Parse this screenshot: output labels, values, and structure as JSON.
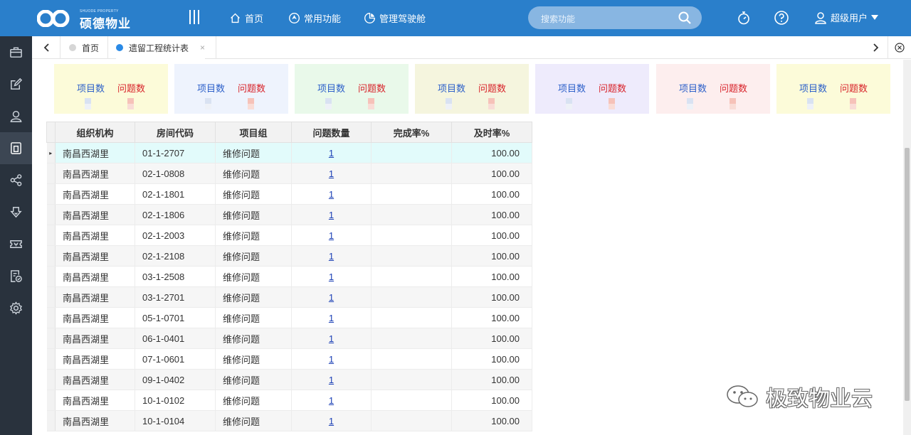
{
  "app": {
    "logo_small": "SHUODE PROPERTY",
    "logo_name": "硕德物业",
    "colors": {
      "topbar": "#2a7fcb",
      "sidebar": "#29323d",
      "link": "#1a3fb5",
      "problem_red": "#d8232a",
      "project_blue": "#2b5fc9"
    }
  },
  "header": {
    "menu_icon": "menu-bars-icon",
    "nav": [
      {
        "label": "首页",
        "icon": "home-icon"
      },
      {
        "label": "常用功能",
        "icon": "navigation-icon"
      },
      {
        "label": "管理驾驶舱",
        "icon": "pie-chart-icon"
      }
    ],
    "search_placeholder": "搜索功能",
    "user_label": "超级用户"
  },
  "sidebar": {
    "items": [
      {
        "icon": "briefcase-icon"
      },
      {
        "icon": "edit-icon"
      },
      {
        "icon": "user-icon"
      },
      {
        "icon": "building-icon",
        "active": true
      },
      {
        "icon": "share-icon"
      },
      {
        "icon": "download-icon"
      },
      {
        "icon": "ticket-icon"
      },
      {
        "icon": "checklist-icon"
      },
      {
        "icon": "settings-icon"
      }
    ]
  },
  "tabs": [
    {
      "label": "首页",
      "dot": "#d6d6d6"
    },
    {
      "label": "遗留工程统计表",
      "dot": "#2a8ae6",
      "active": true,
      "close": "×"
    }
  ],
  "cards": [
    {
      "project_label": "项目数",
      "problem_label": "问题数",
      "bg": "#fcfbd9"
    },
    {
      "project_label": "项目数",
      "problem_label": "问题数",
      "bg": "#eef3fd"
    },
    {
      "project_label": "项目数",
      "problem_label": "问题数",
      "bg": "#e9f9ea"
    },
    {
      "project_label": "项目数",
      "problem_label": "问题数",
      "bg": "#f5f5de"
    },
    {
      "project_label": "项目数",
      "problem_label": "问题数",
      "bg": "#eeebfc"
    },
    {
      "project_label": "项目数",
      "problem_label": "问题数",
      "bg": "#fdeeee"
    },
    {
      "project_label": "项目数",
      "problem_label": "问题数",
      "bg": "#fcfbd9"
    }
  ],
  "table": {
    "columns": [
      "组织机构",
      "房间代码",
      "项目组",
      "问题数量",
      "完成率%",
      "及时率%"
    ],
    "rows": [
      {
        "org": "南昌西湖里",
        "room": "01-1-2707",
        "group": "维修问题",
        "count": "1",
        "completion": "",
        "timely": "100.00"
      },
      {
        "org": "南昌西湖里",
        "room": "02-1-0808",
        "group": "维修问题",
        "count": "1",
        "completion": "",
        "timely": "100.00"
      },
      {
        "org": "南昌西湖里",
        "room": "02-1-1801",
        "group": "维修问题",
        "count": "1",
        "completion": "",
        "timely": "100.00"
      },
      {
        "org": "南昌西湖里",
        "room": "02-1-1806",
        "group": "维修问题",
        "count": "1",
        "completion": "",
        "timely": "100.00"
      },
      {
        "org": "南昌西湖里",
        "room": "02-1-2003",
        "group": "维修问题",
        "count": "1",
        "completion": "",
        "timely": "100.00"
      },
      {
        "org": "南昌西湖里",
        "room": "02-1-2108",
        "group": "维修问题",
        "count": "1",
        "completion": "",
        "timely": "100.00"
      },
      {
        "org": "南昌西湖里",
        "room": "03-1-2508",
        "group": "维修问题",
        "count": "1",
        "completion": "",
        "timely": "100.00"
      },
      {
        "org": "南昌西湖里",
        "room": "03-1-2701",
        "group": "维修问题",
        "count": "1",
        "completion": "",
        "timely": "100.00"
      },
      {
        "org": "南昌西湖里",
        "room": "05-1-0701",
        "group": "维修问题",
        "count": "1",
        "completion": "",
        "timely": "100.00"
      },
      {
        "org": "南昌西湖里",
        "room": "06-1-0401",
        "group": "维修问题",
        "count": "1",
        "completion": "",
        "timely": "100.00"
      },
      {
        "org": "南昌西湖里",
        "room": "07-1-0601",
        "group": "维修问题",
        "count": "1",
        "completion": "",
        "timely": "100.00"
      },
      {
        "org": "南昌西湖里",
        "room": "09-1-0402",
        "group": "维修问题",
        "count": "1",
        "completion": "",
        "timely": "100.00"
      },
      {
        "org": "南昌西湖里",
        "room": "10-1-0102",
        "group": "维修问题",
        "count": "1",
        "completion": "",
        "timely": "100.00"
      },
      {
        "org": "南昌西湖里",
        "room": "10-1-0104",
        "group": "维修问题",
        "count": "1",
        "completion": "",
        "timely": "100.00"
      }
    ]
  },
  "watermark": {
    "text": "极致物业云",
    "icon": "wechat-icon"
  }
}
